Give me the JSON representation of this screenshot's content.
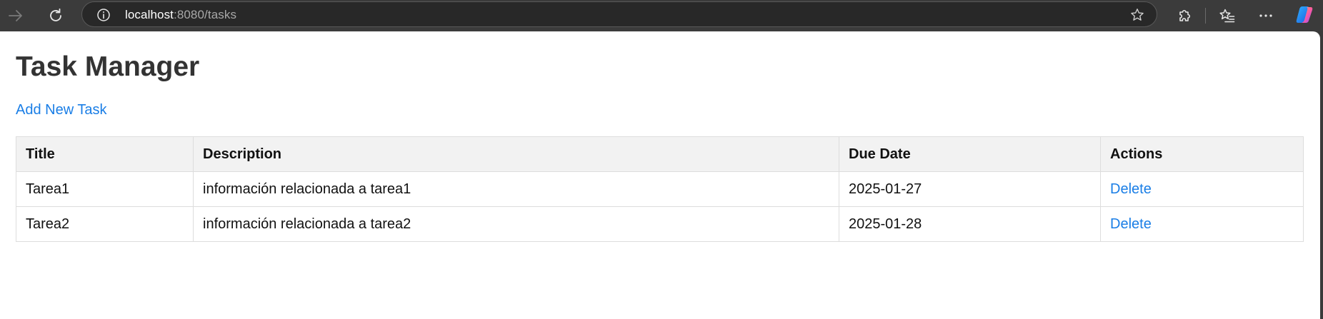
{
  "browser": {
    "url_host": "localhost",
    "url_path": ":8080/tasks",
    "icons": {
      "forward": "arrow-right-icon",
      "reload": "reload-icon",
      "site_info": "info-icon",
      "favorite": "star-icon",
      "extensions": "puzzle-icon",
      "favorites": "favorites-list-icon",
      "more": "more-dots-icon",
      "copilot": "copilot-icon"
    }
  },
  "page": {
    "title": "Task Manager",
    "add_link": "Add New Task"
  },
  "table": {
    "headers": {
      "title": "Title",
      "description": "Description",
      "due_date": "Due Date",
      "actions": "Actions"
    },
    "rows": [
      {
        "title": "Tarea1",
        "description": "información relacionada a tarea1",
        "due_date": "2025-01-27",
        "action": "Delete"
      },
      {
        "title": "Tarea2",
        "description": "información relacionada a tarea2",
        "due_date": "2025-01-28",
        "action": "Delete"
      }
    ]
  },
  "colors": {
    "link": "#1a7ee6",
    "title": "#333333",
    "header_bg": "#f2f2f2",
    "border": "#dddddd",
    "chrome_bg": "#3b3b3b",
    "address_bg": "#282828"
  }
}
